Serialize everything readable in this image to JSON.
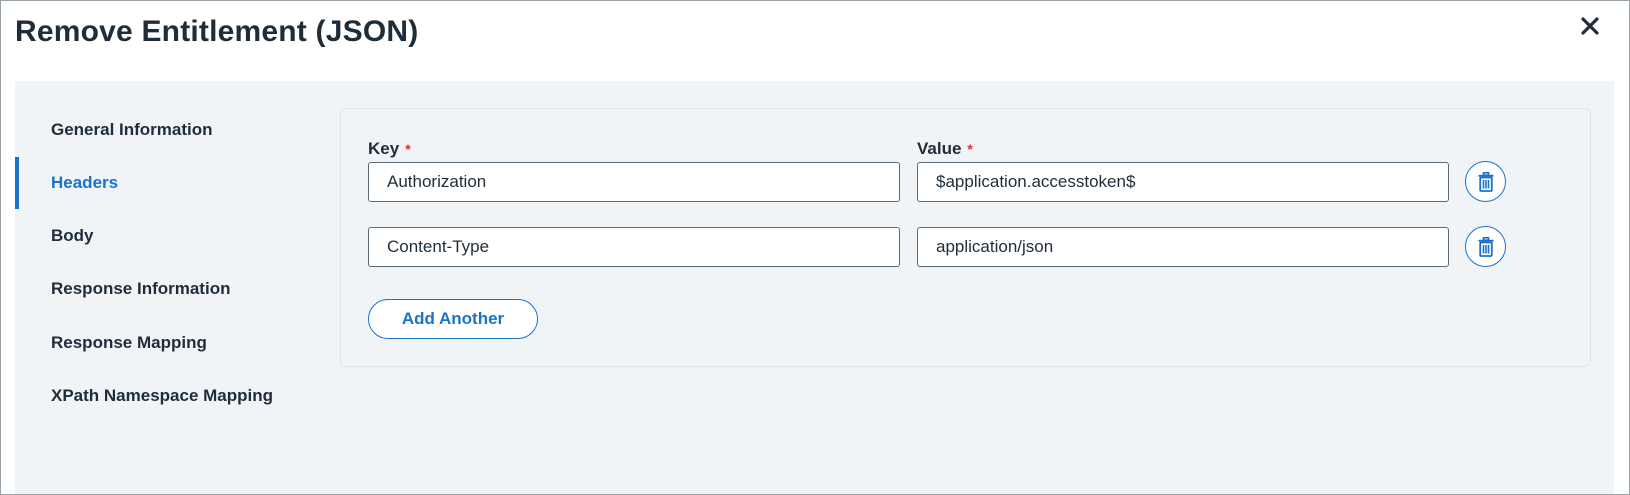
{
  "dialog": {
    "title": "Remove Entitlement (JSON)",
    "close_icon": "close-icon"
  },
  "nav": {
    "items": [
      {
        "label": "General Information",
        "active": false
      },
      {
        "label": "Headers",
        "active": true
      },
      {
        "label": "Body",
        "active": false
      },
      {
        "label": "Response Information",
        "active": false
      },
      {
        "label": "Response Mapping",
        "active": false
      },
      {
        "label": "XPath Namespace Mapping",
        "active": false
      }
    ]
  },
  "headers": {
    "key_label": "Key",
    "value_label": "Value",
    "required_mark": "*",
    "rows": [
      {
        "key": "Authorization",
        "value": "$application.accesstoken$",
        "delete_icon": "trash-icon"
      },
      {
        "key": "Content-Type",
        "value": "application/json",
        "delete_icon": "trash-icon"
      }
    ],
    "add_button_label": "Add Another"
  },
  "colors": {
    "accent": "#1a73c9",
    "required": "#e02b3b",
    "panel_bg": "#f1f4f7",
    "text": "#1f2d3a"
  }
}
